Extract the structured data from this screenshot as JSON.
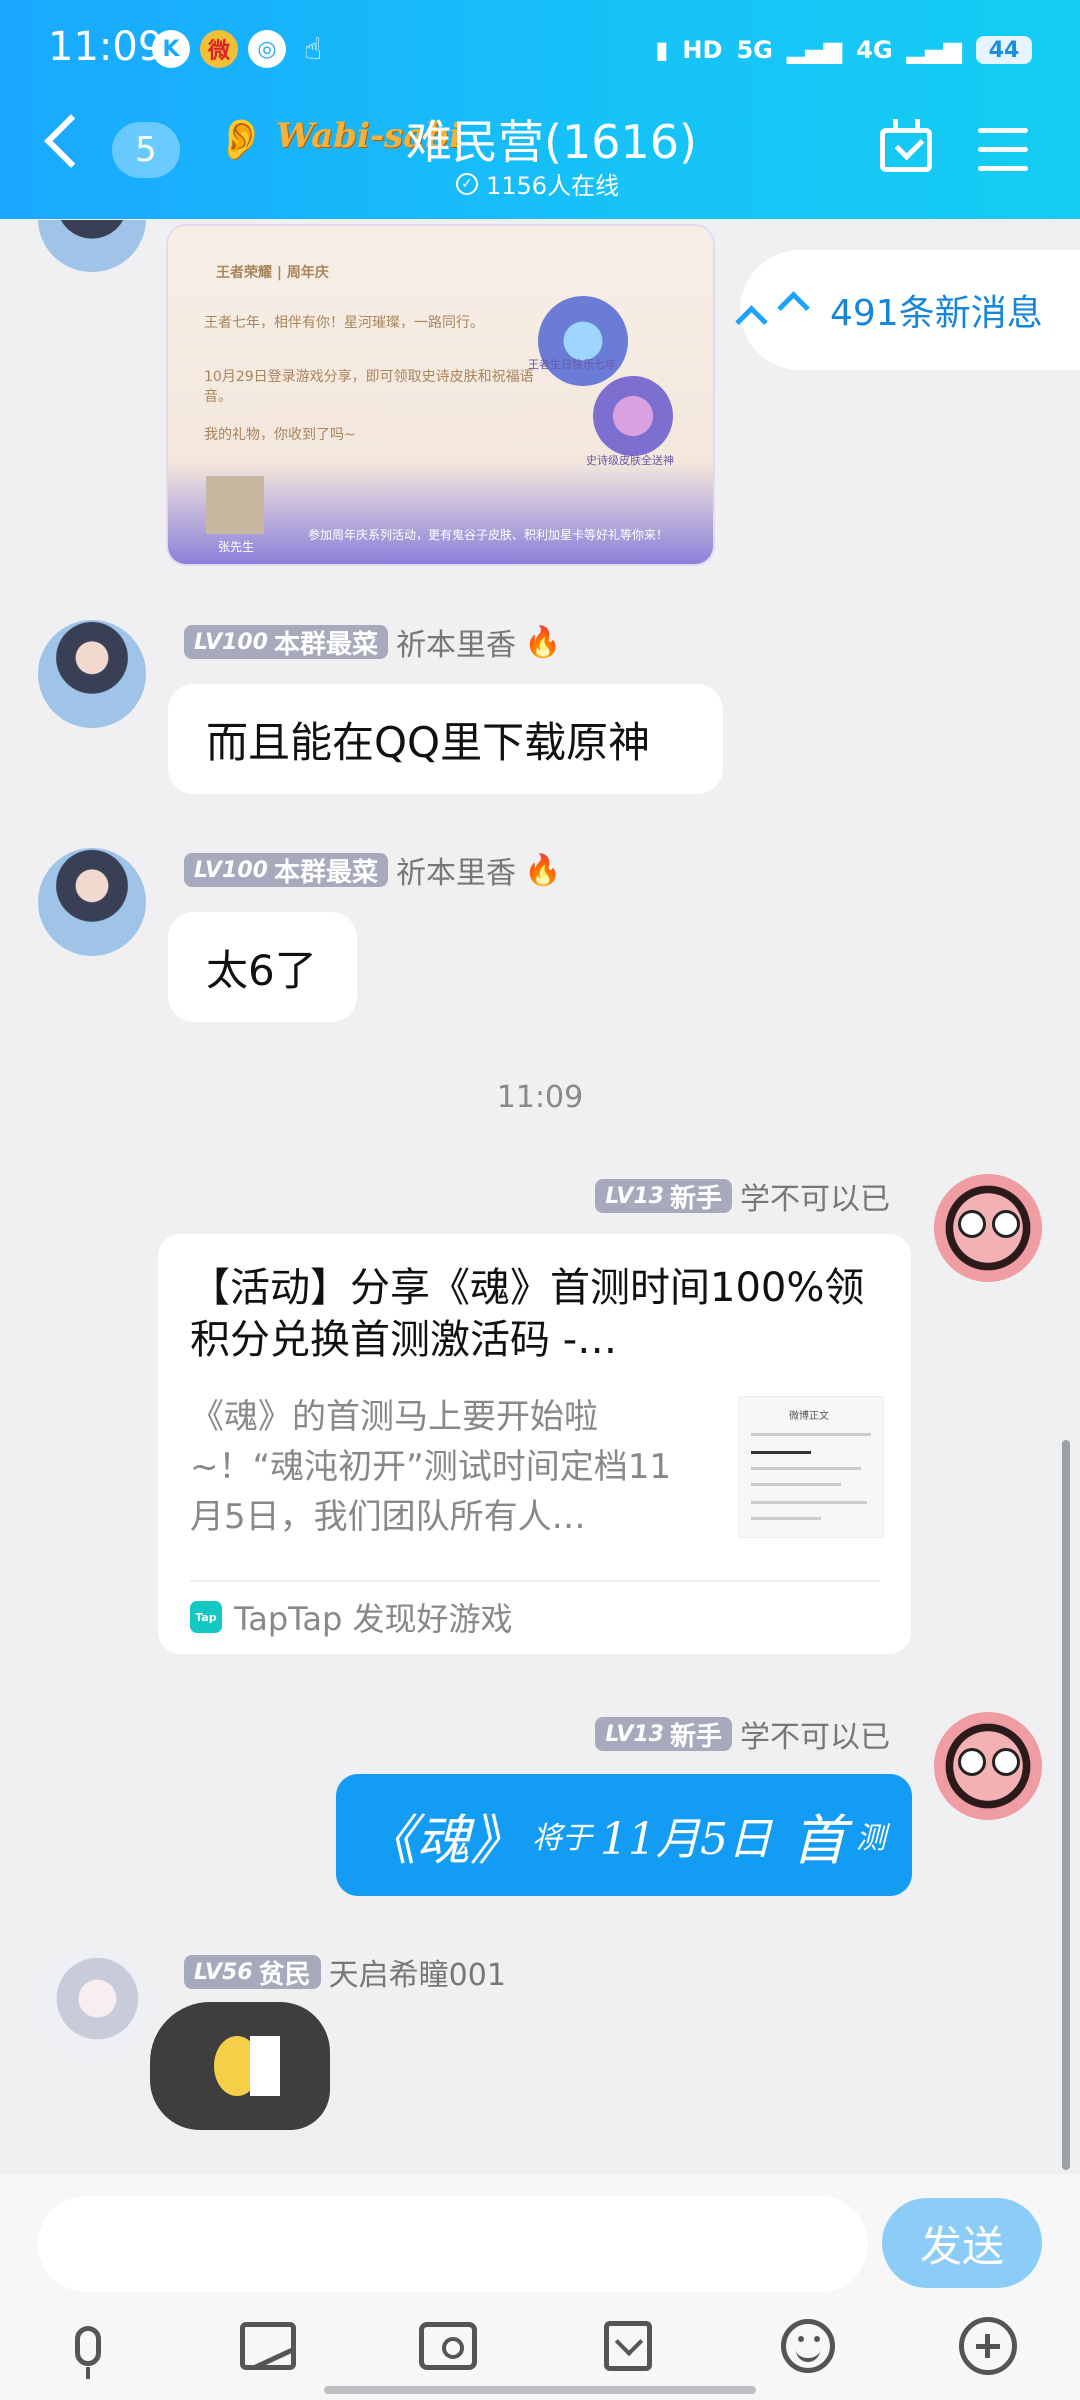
{
  "status_bar": {
    "time": "11:09",
    "battery": "44",
    "network1": "5G",
    "network2": "4G",
    "hd": "HD"
  },
  "header": {
    "unread_count": "5",
    "logo_text": "Wabi-sabi",
    "title": "难民营(1616)",
    "online_text": "1156人在线"
  },
  "new_messages": {
    "label": "491条新消息"
  },
  "image_card": {
    "line1": "王者荣耀 | 周年庆",
    "line2": "王者七年，相伴有你！星河璀璨，一路同行。",
    "line3": "10月29日登录游戏分享，即可领取史诗皮肤和祝福语音。",
    "line4": "我的礼物，你收到了吗~",
    "line5": "参加周年庆系列活动，更有鬼谷子皮肤、积利加星卡等好礼等你来！",
    "bubble1": "王者生日快乐七年",
    "bubble2": "史诗级皮肤全送神",
    "sender": "张先生"
  },
  "messages": [
    {
      "level": "LV100",
      "badge": "本群最菜",
      "name": "祈本里香",
      "text": "而且能在QQ里下载原神"
    },
    {
      "level": "LV100",
      "badge": "本群最菜",
      "name": "祈本里香",
      "text": "太6了"
    }
  ],
  "timestamp": "11:09",
  "link_message": {
    "level": "LV13",
    "badge": "新手",
    "name": "学不可以已",
    "title": "【活动】分享《魂》首测时间100%领积分兑换首测激活码 -…",
    "desc": "《魂》的首测马上要开始啦~！“魂沌初开”测试时间定档11月5日，我们团队所有人…",
    "thumb_title": "微博正文",
    "source": "TapTap 发现好游戏",
    "source_icon": "Tap"
  },
  "art_message": {
    "level": "LV13",
    "badge": "新手",
    "name": "学不可以已",
    "part1": "《魂》",
    "part2": "将于",
    "part3": "11月5日",
    "part4": "首",
    "part5": "测"
  },
  "sticker_message": {
    "level": "LV56",
    "badge": "贫民",
    "name": "天启希瞳001"
  },
  "input": {
    "value": "",
    "placeholder": "",
    "send_label": "发送"
  },
  "colors": {
    "header_start": "#1aa8ff",
    "header_end": "#14cdf3",
    "bubble_blue": "#139cf3",
    "badge_gray": "#a7aabd",
    "send_button": "#8ccdf7"
  }
}
